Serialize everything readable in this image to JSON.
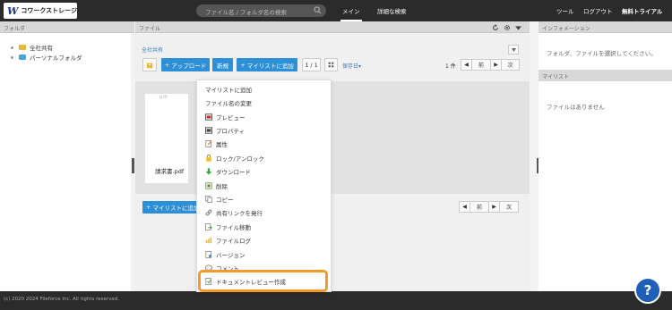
{
  "app": {
    "logo_text": "コワークストレージ",
    "logo_mark": "W"
  },
  "header": {
    "search_placeholder": "ファイル名 / フォルダ名の検索",
    "nav_main": "メイン",
    "nav_advanced_search": "詳細な検索",
    "nav_tools": "ツール",
    "nav_logout": "ログアウト",
    "nav_trial": "無料トライアル"
  },
  "left_panel": {
    "title": "フォルダ",
    "items": [
      {
        "label": "全社共有",
        "color": "#e8b83b"
      },
      {
        "label": "パーソナルフォルダ",
        "color": "#4aa3e0"
      }
    ]
  },
  "center": {
    "title": "ファイル",
    "breadcrumb": "全社共有",
    "toolbar": {
      "upload": "アップロード",
      "new": "新規",
      "add_mylist": "マイリストに追加",
      "page_indicator": "1 / 1",
      "sort": "保存日",
      "count": "1 件",
      "prev": "前",
      "next": "次"
    },
    "file": {
      "ext": "pdf",
      "name": "請求書.pdf"
    },
    "bottom_add_mylist": "マイリストに追加"
  },
  "context_menu": {
    "items": [
      {
        "label": "マイリストに追加",
        "icon": "none"
      },
      {
        "label": "ファイル名の変更",
        "icon": "none"
      },
      {
        "label": "プレビュー",
        "icon": "preview-icon"
      },
      {
        "label": "プロパティ",
        "icon": "properties-icon"
      },
      {
        "label": "属性",
        "icon": "attribute-icon"
      },
      {
        "label": "ロック/アンロック",
        "icon": "lock-icon"
      },
      {
        "label": "ダウンロード",
        "icon": "download-icon"
      },
      {
        "label": "削除",
        "icon": "delete-icon"
      },
      {
        "label": "コピー",
        "icon": "copy-icon"
      },
      {
        "label": "共有リンクを発行",
        "icon": "link-icon"
      },
      {
        "label": "ファイル移動",
        "icon": "move-icon"
      },
      {
        "label": "ファイルログ",
        "icon": "log-icon"
      },
      {
        "label": "バージョン",
        "icon": "version-icon"
      },
      {
        "label": "コメント",
        "icon": "comment-icon"
      },
      {
        "label": "ドキュメントレビュー作成",
        "icon": "review-icon"
      }
    ]
  },
  "right_panel": {
    "info_title": "インフォメーション",
    "info_text": "フォルダ、ファイルを選択してください。",
    "mylist_title": "マイリスト",
    "mylist_text": "ファイルはありません"
  },
  "footer": {
    "copyright": "(c) 2020 2024 Fileforce Inc. All rights reserved."
  },
  "help_label": "?"
}
